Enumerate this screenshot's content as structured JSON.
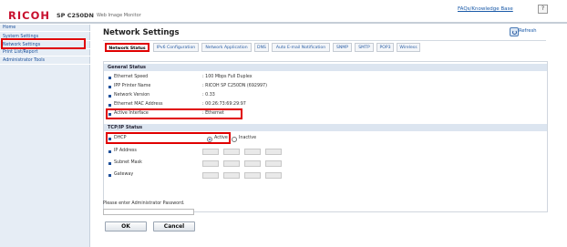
{
  "header": {
    "brand": "RICOH",
    "model": "SP C250DN",
    "web_title": "Web Image Monitor",
    "faq_link": "FAQs/Knowledge Base",
    "help_icon": "?"
  },
  "sidebar": {
    "items": [
      {
        "label": "Home"
      },
      {
        "label": "System Settings"
      },
      {
        "label": "Network Settings"
      },
      {
        "label": "Print List/Report"
      },
      {
        "label": "Administrator Tools"
      }
    ]
  },
  "page": {
    "title": "Network Settings",
    "refresh_label": "Refresh",
    "tabs": [
      {
        "label": "Network Status",
        "active": true
      },
      {
        "label": "IPv6 Configuration"
      },
      {
        "label": "Network Application"
      },
      {
        "label": "DNS"
      },
      {
        "label": "Auto E-mail Notification"
      },
      {
        "label": "SNMP"
      },
      {
        "label": "SMTP"
      },
      {
        "label": "POP3"
      },
      {
        "label": "Wireless"
      }
    ]
  },
  "general_status": {
    "heading": "General Status",
    "rows": [
      {
        "label": "Ethernet Speed",
        "value": ": 100 Mbps Full Duplex"
      },
      {
        "label": "IPP Printer Name",
        "value": ": RICOH SP C250DN (692997)"
      },
      {
        "label": "Network Version",
        "value": ": 0.33"
      },
      {
        "label": "Ethernet MAC Address",
        "value": ": 00:26:73:69:29:97"
      },
      {
        "label": "Active Interface",
        "value": ": Ethernet"
      }
    ]
  },
  "tcpip_status": {
    "heading": "TCP/IP Status",
    "dhcp": {
      "label": "DHCP",
      "active_label": "Active",
      "inactive_label": "Inactive",
      "selected": "Active"
    },
    "fields": [
      {
        "label": "IP Address"
      },
      {
        "label": "Subnet Mask"
      },
      {
        "label": "Gateway"
      }
    ]
  },
  "footer": {
    "password_prompt": "Please enter Administrator Password.",
    "ok_label": "OK",
    "cancel_label": "Cancel"
  },
  "colors": {
    "highlight": "#e00000",
    "brand_red": "#c8102e",
    "link_blue": "#1a5aa8",
    "section_bar": "#dce5f0",
    "sidebar_bg": "#e6edf5"
  }
}
